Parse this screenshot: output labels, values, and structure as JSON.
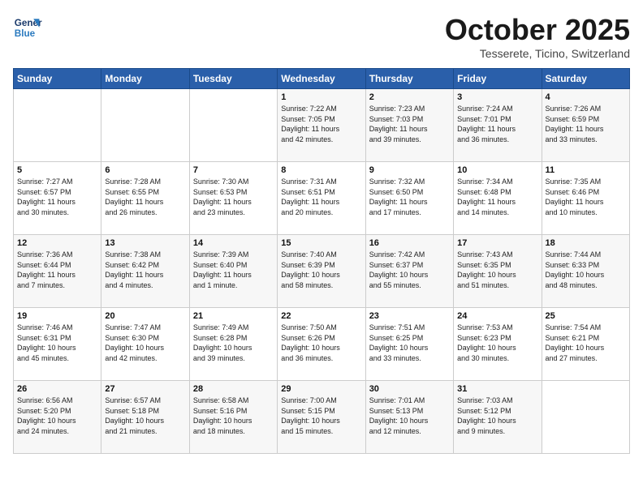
{
  "header": {
    "logo_line1": "General",
    "logo_line2": "Blue",
    "month": "October 2025",
    "location": "Tesserete, Ticino, Switzerland"
  },
  "weekdays": [
    "Sunday",
    "Monday",
    "Tuesday",
    "Wednesday",
    "Thursday",
    "Friday",
    "Saturday"
  ],
  "weeks": [
    [
      {
        "day": "",
        "info": ""
      },
      {
        "day": "",
        "info": ""
      },
      {
        "day": "",
        "info": ""
      },
      {
        "day": "1",
        "info": "Sunrise: 7:22 AM\nSunset: 7:05 PM\nDaylight: 11 hours\nand 42 minutes."
      },
      {
        "day": "2",
        "info": "Sunrise: 7:23 AM\nSunset: 7:03 PM\nDaylight: 11 hours\nand 39 minutes."
      },
      {
        "day": "3",
        "info": "Sunrise: 7:24 AM\nSunset: 7:01 PM\nDaylight: 11 hours\nand 36 minutes."
      },
      {
        "day": "4",
        "info": "Sunrise: 7:26 AM\nSunset: 6:59 PM\nDaylight: 11 hours\nand 33 minutes."
      }
    ],
    [
      {
        "day": "5",
        "info": "Sunrise: 7:27 AM\nSunset: 6:57 PM\nDaylight: 11 hours\nand 30 minutes."
      },
      {
        "day": "6",
        "info": "Sunrise: 7:28 AM\nSunset: 6:55 PM\nDaylight: 11 hours\nand 26 minutes."
      },
      {
        "day": "7",
        "info": "Sunrise: 7:30 AM\nSunset: 6:53 PM\nDaylight: 11 hours\nand 23 minutes."
      },
      {
        "day": "8",
        "info": "Sunrise: 7:31 AM\nSunset: 6:51 PM\nDaylight: 11 hours\nand 20 minutes."
      },
      {
        "day": "9",
        "info": "Sunrise: 7:32 AM\nSunset: 6:50 PM\nDaylight: 11 hours\nand 17 minutes."
      },
      {
        "day": "10",
        "info": "Sunrise: 7:34 AM\nSunset: 6:48 PM\nDaylight: 11 hours\nand 14 minutes."
      },
      {
        "day": "11",
        "info": "Sunrise: 7:35 AM\nSunset: 6:46 PM\nDaylight: 11 hours\nand 10 minutes."
      }
    ],
    [
      {
        "day": "12",
        "info": "Sunrise: 7:36 AM\nSunset: 6:44 PM\nDaylight: 11 hours\nand 7 minutes."
      },
      {
        "day": "13",
        "info": "Sunrise: 7:38 AM\nSunset: 6:42 PM\nDaylight: 11 hours\nand 4 minutes."
      },
      {
        "day": "14",
        "info": "Sunrise: 7:39 AM\nSunset: 6:40 PM\nDaylight: 11 hours\nand 1 minute."
      },
      {
        "day": "15",
        "info": "Sunrise: 7:40 AM\nSunset: 6:39 PM\nDaylight: 10 hours\nand 58 minutes."
      },
      {
        "day": "16",
        "info": "Sunrise: 7:42 AM\nSunset: 6:37 PM\nDaylight: 10 hours\nand 55 minutes."
      },
      {
        "day": "17",
        "info": "Sunrise: 7:43 AM\nSunset: 6:35 PM\nDaylight: 10 hours\nand 51 minutes."
      },
      {
        "day": "18",
        "info": "Sunrise: 7:44 AM\nSunset: 6:33 PM\nDaylight: 10 hours\nand 48 minutes."
      }
    ],
    [
      {
        "day": "19",
        "info": "Sunrise: 7:46 AM\nSunset: 6:31 PM\nDaylight: 10 hours\nand 45 minutes."
      },
      {
        "day": "20",
        "info": "Sunrise: 7:47 AM\nSunset: 6:30 PM\nDaylight: 10 hours\nand 42 minutes."
      },
      {
        "day": "21",
        "info": "Sunrise: 7:49 AM\nSunset: 6:28 PM\nDaylight: 10 hours\nand 39 minutes."
      },
      {
        "day": "22",
        "info": "Sunrise: 7:50 AM\nSunset: 6:26 PM\nDaylight: 10 hours\nand 36 minutes."
      },
      {
        "day": "23",
        "info": "Sunrise: 7:51 AM\nSunset: 6:25 PM\nDaylight: 10 hours\nand 33 minutes."
      },
      {
        "day": "24",
        "info": "Sunrise: 7:53 AM\nSunset: 6:23 PM\nDaylight: 10 hours\nand 30 minutes."
      },
      {
        "day": "25",
        "info": "Sunrise: 7:54 AM\nSunset: 6:21 PM\nDaylight: 10 hours\nand 27 minutes."
      }
    ],
    [
      {
        "day": "26",
        "info": "Sunrise: 6:56 AM\nSunset: 5:20 PM\nDaylight: 10 hours\nand 24 minutes."
      },
      {
        "day": "27",
        "info": "Sunrise: 6:57 AM\nSunset: 5:18 PM\nDaylight: 10 hours\nand 21 minutes."
      },
      {
        "day": "28",
        "info": "Sunrise: 6:58 AM\nSunset: 5:16 PM\nDaylight: 10 hours\nand 18 minutes."
      },
      {
        "day": "29",
        "info": "Sunrise: 7:00 AM\nSunset: 5:15 PM\nDaylight: 10 hours\nand 15 minutes."
      },
      {
        "day": "30",
        "info": "Sunrise: 7:01 AM\nSunset: 5:13 PM\nDaylight: 10 hours\nand 12 minutes."
      },
      {
        "day": "31",
        "info": "Sunrise: 7:03 AM\nSunset: 5:12 PM\nDaylight: 10 hours\nand 9 minutes."
      },
      {
        "day": "",
        "info": ""
      }
    ]
  ]
}
